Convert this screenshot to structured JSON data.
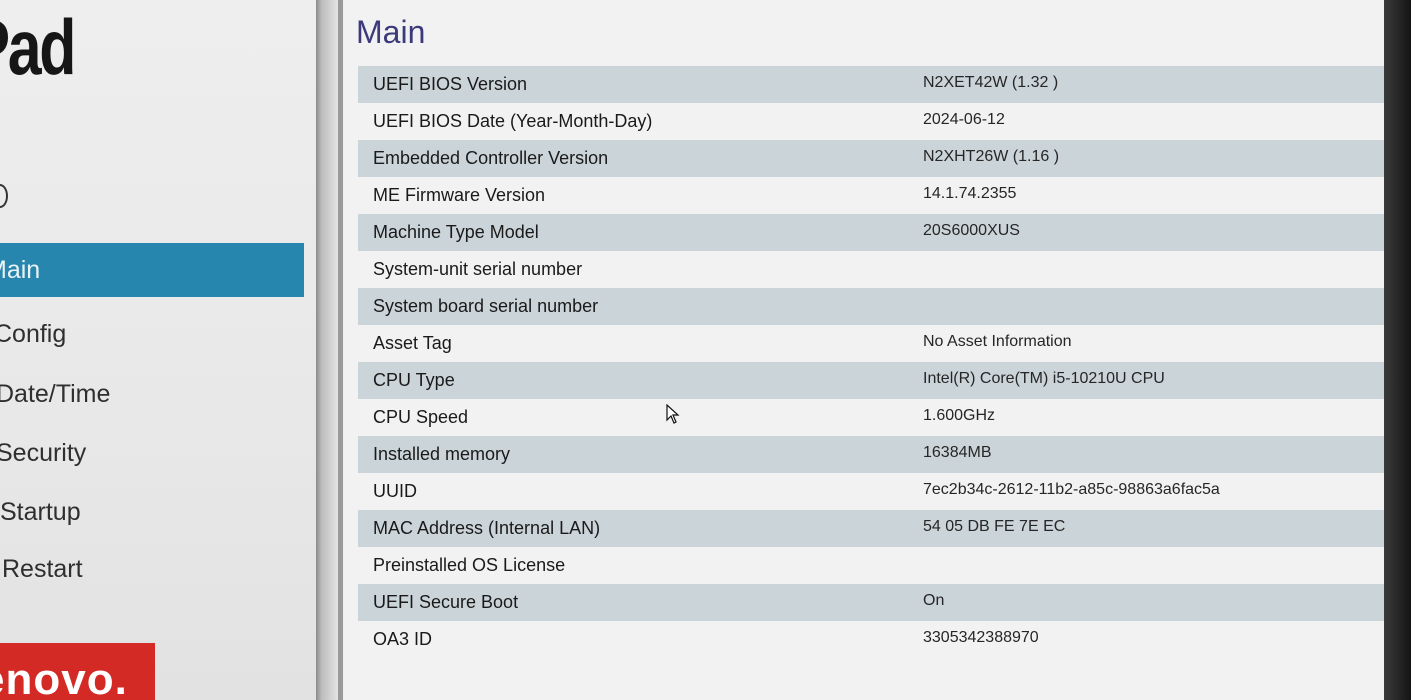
{
  "sidebar": {
    "brand": "kPad",
    "nav": [
      {
        "label": "Main",
        "active": true
      },
      {
        "label": "Config",
        "active": false
      },
      {
        "label": "Date/Time",
        "active": false
      },
      {
        "label": "Security",
        "active": false
      },
      {
        "label": "Startup",
        "active": false
      },
      {
        "label": "Restart",
        "active": false
      }
    ],
    "logo_text": "enovo."
  },
  "main": {
    "title": "Main",
    "rows": [
      {
        "label": "UEFI BIOS Version",
        "value": "N2XET42W (1.32 )"
      },
      {
        "label": "UEFI BIOS Date (Year-Month-Day)",
        "value": "2024-06-12"
      },
      {
        "label": "Embedded Controller Version",
        "value": "N2XHT26W (1.16 )"
      },
      {
        "label": "ME Firmware Version",
        "value": "14.1.74.2355"
      },
      {
        "label": "Machine Type Model",
        "value": "20S6000XUS"
      },
      {
        "label": "System-unit serial number",
        "value": ""
      },
      {
        "label": "System board serial number",
        "value": ""
      },
      {
        "label": "Asset Tag",
        "value": "No Asset Information"
      },
      {
        "label": "CPU Type",
        "value": "Intel(R) Core(TM) i5-10210U CPU"
      },
      {
        "label": "CPU Speed",
        "value": "1.600GHz"
      },
      {
        "label": "Installed memory",
        "value": "16384MB"
      },
      {
        "label": "UUID",
        "value": "7ec2b34c-2612-11b2-a85c-98863a6fac5a"
      },
      {
        "label": "MAC Address (Internal LAN)",
        "value": "54 05 DB FE 7E EC"
      },
      {
        "label": "Preinstalled OS License",
        "value": ""
      },
      {
        "label": "UEFI Secure Boot",
        "value": "On"
      },
      {
        "label": "OA3 ID",
        "value": "3305342388970"
      }
    ]
  },
  "colors": {
    "active_nav": "#2786ad",
    "title": "#3c3a7a",
    "row_shade": "#cbd4d9",
    "logo_bg": "#d32a25"
  }
}
